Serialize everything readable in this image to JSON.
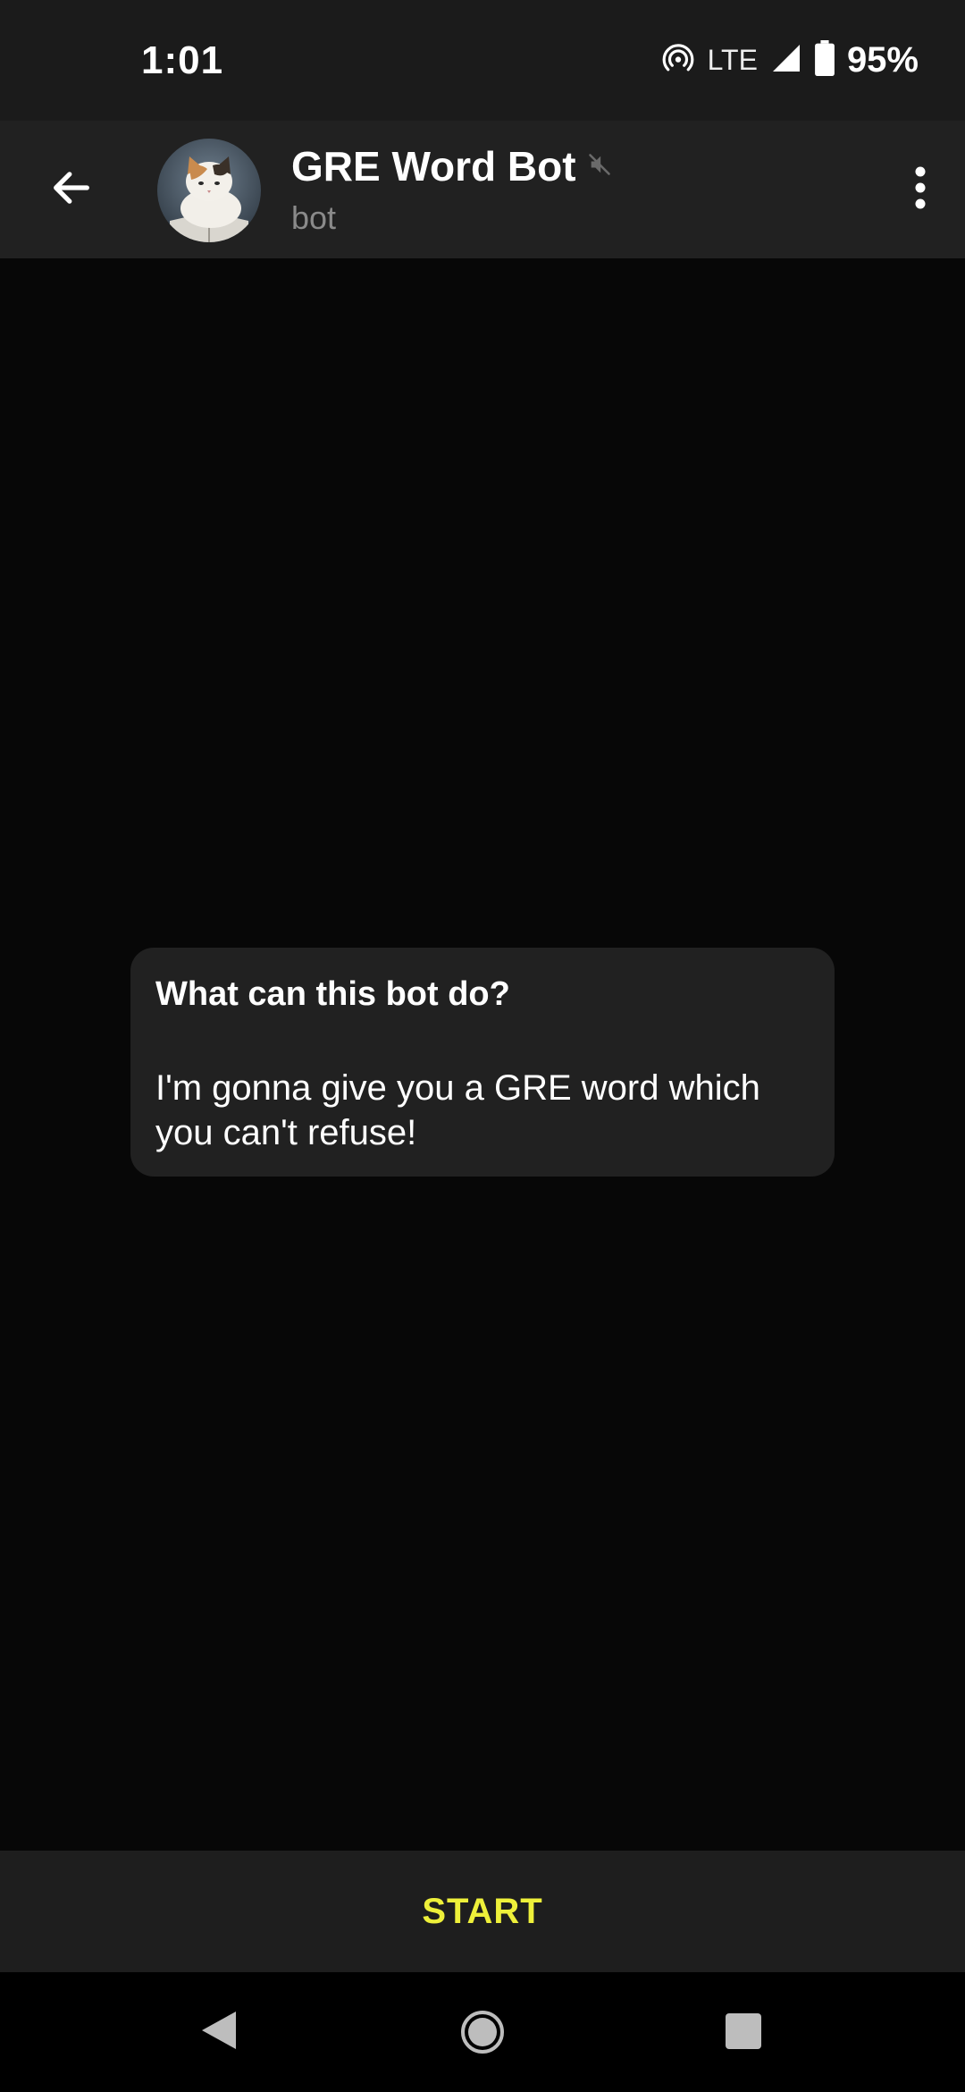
{
  "status_bar": {
    "time": "1:01",
    "network": "LTE",
    "battery": "95%",
    "icons": [
      "hotspot-icon",
      "signal-icon",
      "battery-icon"
    ]
  },
  "header": {
    "title": "GRE Word Bot",
    "subtitle": "bot",
    "muted": true,
    "icons": [
      "back-arrow-icon",
      "avatar",
      "mute-icon",
      "more-vert-icon"
    ]
  },
  "bot_info": {
    "title": "What can this bot do?",
    "text": "I'm gonna give you a GRE word which you can't refuse!"
  },
  "start_bar": {
    "label": "START",
    "color": "#eef03a"
  },
  "nav_bar": {
    "icons": [
      "nav-back-icon",
      "nav-home-icon",
      "nav-recents-icon"
    ]
  }
}
